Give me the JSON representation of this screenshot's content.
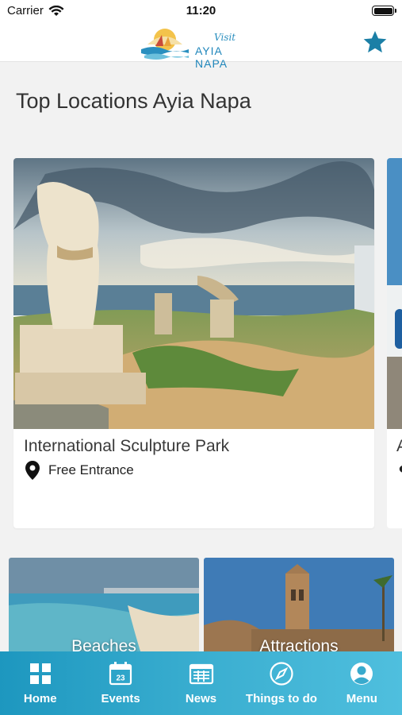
{
  "status_bar": {
    "carrier": "Carrier",
    "time": "11:20"
  },
  "header": {
    "logo_script": "Visit",
    "logo_name": "AYIA NAPA",
    "favorite_icon": "star-icon",
    "accent_color": "#1b7fa6"
  },
  "section": {
    "title": "Top Locations Ayia Napa"
  },
  "locations": [
    {
      "title": "International Sculpture Park",
      "meta_icon": "location-pin-icon",
      "meta_text": "Free Entrance"
    },
    {
      "title": "A"
    }
  ],
  "categories": [
    {
      "label": "Beaches"
    },
    {
      "label": "Attractions"
    }
  ],
  "tab_bar": {
    "tabs": [
      {
        "label": "Home",
        "icon": "grid-icon"
      },
      {
        "label": "Events",
        "icon": "calendar-icon",
        "icon_text": "23"
      },
      {
        "label": "News",
        "icon": "newspaper-icon"
      },
      {
        "label": "Things to do",
        "icon": "compass-icon"
      },
      {
        "label": "Menu",
        "icon": "user-icon"
      }
    ],
    "colors": [
      "#1d97bf",
      "#4fbfde"
    ]
  }
}
